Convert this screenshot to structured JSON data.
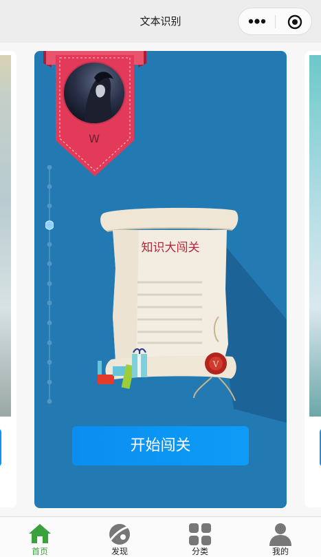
{
  "navbar": {
    "title": "文本识别",
    "more_icon": "more-dots-icon",
    "close_icon": "mini-program-close-icon"
  },
  "main_card": {
    "username": "W",
    "scroll_title": "知识大闯关",
    "start_button": "开始闯关",
    "colors": {
      "card_bg": "#2379b1",
      "ribbon": "#e23a58",
      "button": "#0b8ef0"
    }
  },
  "tabbar": {
    "active_color": "#3aa23c",
    "items": [
      {
        "label": "首页",
        "icon": "home-icon"
      },
      {
        "label": "发现",
        "icon": "discover-planet-icon"
      },
      {
        "label": "分类",
        "icon": "category-grid-icon"
      },
      {
        "label": "我的",
        "icon": "user-profile-icon"
      }
    ]
  }
}
